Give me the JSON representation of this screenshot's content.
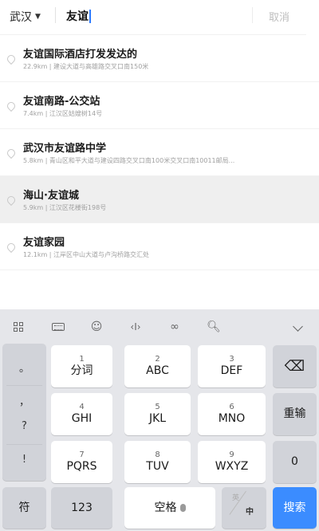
{
  "search": {
    "city": "武汉",
    "query": "友谊",
    "cancel_label": "取消"
  },
  "results": [
    {
      "title": "友谊国际酒店打发发达的",
      "sub": "22.9km | 建设大道与高雄路交叉口南150米"
    },
    {
      "title": "友谊南路-公交站",
      "sub": "7.4km | 江汉区姑嫂树14号"
    },
    {
      "title": "武汉市友谊路中学",
      "sub": "5.8km | 青山区和平大道与建设四路交叉口南100米交叉口南10011邮局..."
    },
    {
      "title": "海山·友谊城",
      "sub": "5.9km | 江汉区花楼街198号"
    },
    {
      "title": "友谊家园",
      "sub": "12.1km | 江岸区中山大道与卢沟桥路交汇处"
    }
  ],
  "keyboard": {
    "toolbar_icons": [
      "grid-icon",
      "keyboard-icon",
      "emoji-icon",
      "cursor-move-icon",
      "link-icon",
      "search-icon",
      "collapse-icon"
    ],
    "punct": [
      "。",
      "，",
      "?",
      "!"
    ],
    "keys": {
      "k1": {
        "num": "1",
        "label": "分词"
      },
      "k2": {
        "num": "2",
        "label": "ABC"
      },
      "k3": {
        "num": "3",
        "label": "DEF"
      },
      "k4": {
        "num": "4",
        "label": "GHI"
      },
      "k5": {
        "num": "5",
        "label": "JKL"
      },
      "k6": {
        "num": "6",
        "label": "MNO"
      },
      "k7": {
        "num": "7",
        "label": "PQRS"
      },
      "k8": {
        "num": "8",
        "label": "TUV"
      },
      "k9": {
        "num": "9",
        "label": "WXYZ"
      }
    },
    "backspace_glyph": "⌫",
    "reenter_label": "重输",
    "zero_label": "0",
    "symbol_label": "符",
    "num_label": "123",
    "space_label": "空格",
    "switch_top": "英",
    "switch_bottom": "中",
    "search_label": "搜索",
    "colors": {
      "accent": "#3b8cff",
      "keyboard_bg": "#e5e6ea",
      "gray_key": "#d1d3d9"
    }
  }
}
